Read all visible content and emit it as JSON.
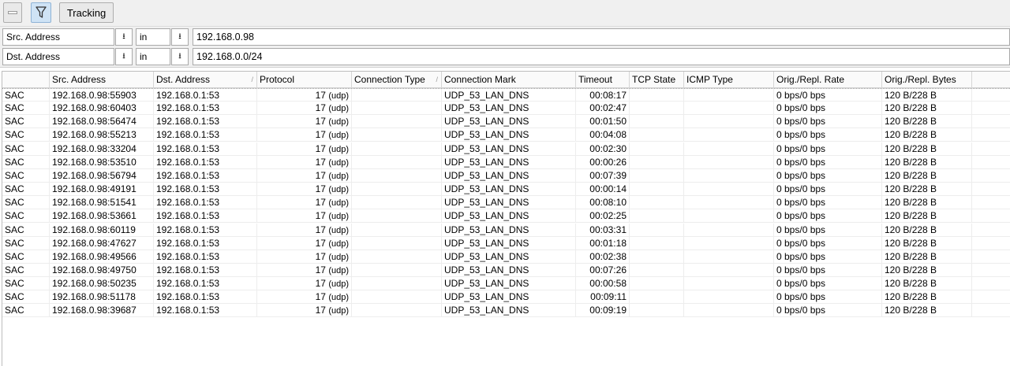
{
  "toolbar": {
    "minus_icon": "minus-icon",
    "filter_icon": "filter-icon",
    "tracking_label": "Tracking"
  },
  "filters": [
    {
      "field": "Src. Address",
      "operator": "in",
      "value": "192.168.0.98"
    },
    {
      "field": "Dst. Address",
      "operator": "in",
      "value": "192.168.0.0/24"
    }
  ],
  "table": {
    "columns": [
      "",
      "Src. Address",
      "Dst. Address",
      "Protocol",
      "Connection Type",
      "Connection Mark",
      "Timeout",
      "TCP State",
      "ICMP Type",
      "Orig./Repl. Rate",
      "Orig./Repl. Bytes",
      ""
    ],
    "rows": [
      {
        "flags": "SAC",
        "src": "192.168.0.98:55903",
        "dst": "192.168.0.1:53",
        "proto": "17",
        "proto_name": "(udp)",
        "type": "",
        "mark": "UDP_53_LAN_DNS",
        "timeout": "00:08:17",
        "tcp": "",
        "icmp": "",
        "rate": "0 bps/0 bps",
        "bytes": "120 B/228 B"
      },
      {
        "flags": "SAC",
        "src": "192.168.0.98:60403",
        "dst": "192.168.0.1:53",
        "proto": "17",
        "proto_name": "(udp)",
        "type": "",
        "mark": "UDP_53_LAN_DNS",
        "timeout": "00:02:47",
        "tcp": "",
        "icmp": "",
        "rate": "0 bps/0 bps",
        "bytes": "120 B/228 B"
      },
      {
        "flags": "SAC",
        "src": "192.168.0.98:56474",
        "dst": "192.168.0.1:53",
        "proto": "17",
        "proto_name": "(udp)",
        "type": "",
        "mark": "UDP_53_LAN_DNS",
        "timeout": "00:01:50",
        "tcp": "",
        "icmp": "",
        "rate": "0 bps/0 bps",
        "bytes": "120 B/228 B"
      },
      {
        "flags": "SAC",
        "src": "192.168.0.98:55213",
        "dst": "192.168.0.1:53",
        "proto": "17",
        "proto_name": "(udp)",
        "type": "",
        "mark": "UDP_53_LAN_DNS",
        "timeout": "00:04:08",
        "tcp": "",
        "icmp": "",
        "rate": "0 bps/0 bps",
        "bytes": "120 B/228 B"
      },
      {
        "flags": "SAC",
        "src": "192.168.0.98:33204",
        "dst": "192.168.0.1:53",
        "proto": "17",
        "proto_name": "(udp)",
        "type": "",
        "mark": "UDP_53_LAN_DNS",
        "timeout": "00:02:30",
        "tcp": "",
        "icmp": "",
        "rate": "0 bps/0 bps",
        "bytes": "120 B/228 B"
      },
      {
        "flags": "SAC",
        "src": "192.168.0.98:53510",
        "dst": "192.168.0.1:53",
        "proto": "17",
        "proto_name": "(udp)",
        "type": "",
        "mark": "UDP_53_LAN_DNS",
        "timeout": "00:00:26",
        "tcp": "",
        "icmp": "",
        "rate": "0 bps/0 bps",
        "bytes": "120 B/228 B"
      },
      {
        "flags": "SAC",
        "src": "192.168.0.98:56794",
        "dst": "192.168.0.1:53",
        "proto": "17",
        "proto_name": "(udp)",
        "type": "",
        "mark": "UDP_53_LAN_DNS",
        "timeout": "00:07:39",
        "tcp": "",
        "icmp": "",
        "rate": "0 bps/0 bps",
        "bytes": "120 B/228 B"
      },
      {
        "flags": "SAC",
        "src": "192.168.0.98:49191",
        "dst": "192.168.0.1:53",
        "proto": "17",
        "proto_name": "(udp)",
        "type": "",
        "mark": "UDP_53_LAN_DNS",
        "timeout": "00:00:14",
        "tcp": "",
        "icmp": "",
        "rate": "0 bps/0 bps",
        "bytes": "120 B/228 B"
      },
      {
        "flags": "SAC",
        "src": "192.168.0.98:51541",
        "dst": "192.168.0.1:53",
        "proto": "17",
        "proto_name": "(udp)",
        "type": "",
        "mark": "UDP_53_LAN_DNS",
        "timeout": "00:08:10",
        "tcp": "",
        "icmp": "",
        "rate": "0 bps/0 bps",
        "bytes": "120 B/228 B"
      },
      {
        "flags": "SAC",
        "src": "192.168.0.98:53661",
        "dst": "192.168.0.1:53",
        "proto": "17",
        "proto_name": "(udp)",
        "type": "",
        "mark": "UDP_53_LAN_DNS",
        "timeout": "00:02:25",
        "tcp": "",
        "icmp": "",
        "rate": "0 bps/0 bps",
        "bytes": "120 B/228 B"
      },
      {
        "flags": "SAC",
        "src": "192.168.0.98:60119",
        "dst": "192.168.0.1:53",
        "proto": "17",
        "proto_name": "(udp)",
        "type": "",
        "mark": "UDP_53_LAN_DNS",
        "timeout": "00:03:31",
        "tcp": "",
        "icmp": "",
        "rate": "0 bps/0 bps",
        "bytes": "120 B/228 B"
      },
      {
        "flags": "SAC",
        "src": "192.168.0.98:47627",
        "dst": "192.168.0.1:53",
        "proto": "17",
        "proto_name": "(udp)",
        "type": "",
        "mark": "UDP_53_LAN_DNS",
        "timeout": "00:01:18",
        "tcp": "",
        "icmp": "",
        "rate": "0 bps/0 bps",
        "bytes": "120 B/228 B"
      },
      {
        "flags": "SAC",
        "src": "192.168.0.98:49566",
        "dst": "192.168.0.1:53",
        "proto": "17",
        "proto_name": "(udp)",
        "type": "",
        "mark": "UDP_53_LAN_DNS",
        "timeout": "00:02:38",
        "tcp": "",
        "icmp": "",
        "rate": "0 bps/0 bps",
        "bytes": "120 B/228 B"
      },
      {
        "flags": "SAC",
        "src": "192.168.0.98:49750",
        "dst": "192.168.0.1:53",
        "proto": "17",
        "proto_name": "(udp)",
        "type": "",
        "mark": "UDP_53_LAN_DNS",
        "timeout": "00:07:26",
        "tcp": "",
        "icmp": "",
        "rate": "0 bps/0 bps",
        "bytes": "120 B/228 B"
      },
      {
        "flags": "SAC",
        "src": "192.168.0.98:50235",
        "dst": "192.168.0.1:53",
        "proto": "17",
        "proto_name": "(udp)",
        "type": "",
        "mark": "UDP_53_LAN_DNS",
        "timeout": "00:00:58",
        "tcp": "",
        "icmp": "",
        "rate": "0 bps/0 bps",
        "bytes": "120 B/228 B"
      },
      {
        "flags": "SAC",
        "src": "192.168.0.98:51178",
        "dst": "192.168.0.1:53",
        "proto": "17",
        "proto_name": "(udp)",
        "type": "",
        "mark": "UDP_53_LAN_DNS",
        "timeout": "00:09:11",
        "tcp": "",
        "icmp": "",
        "rate": "0 bps/0 bps",
        "bytes": "120 B/228 B"
      },
      {
        "flags": "SAC",
        "src": "192.168.0.98:39687",
        "dst": "192.168.0.1:53",
        "proto": "17",
        "proto_name": "(udp)",
        "type": "",
        "mark": "UDP_53_LAN_DNS",
        "timeout": "00:09:19",
        "tcp": "",
        "icmp": "",
        "rate": "0 bps/0 bps",
        "bytes": "120 B/228 B"
      }
    ]
  }
}
